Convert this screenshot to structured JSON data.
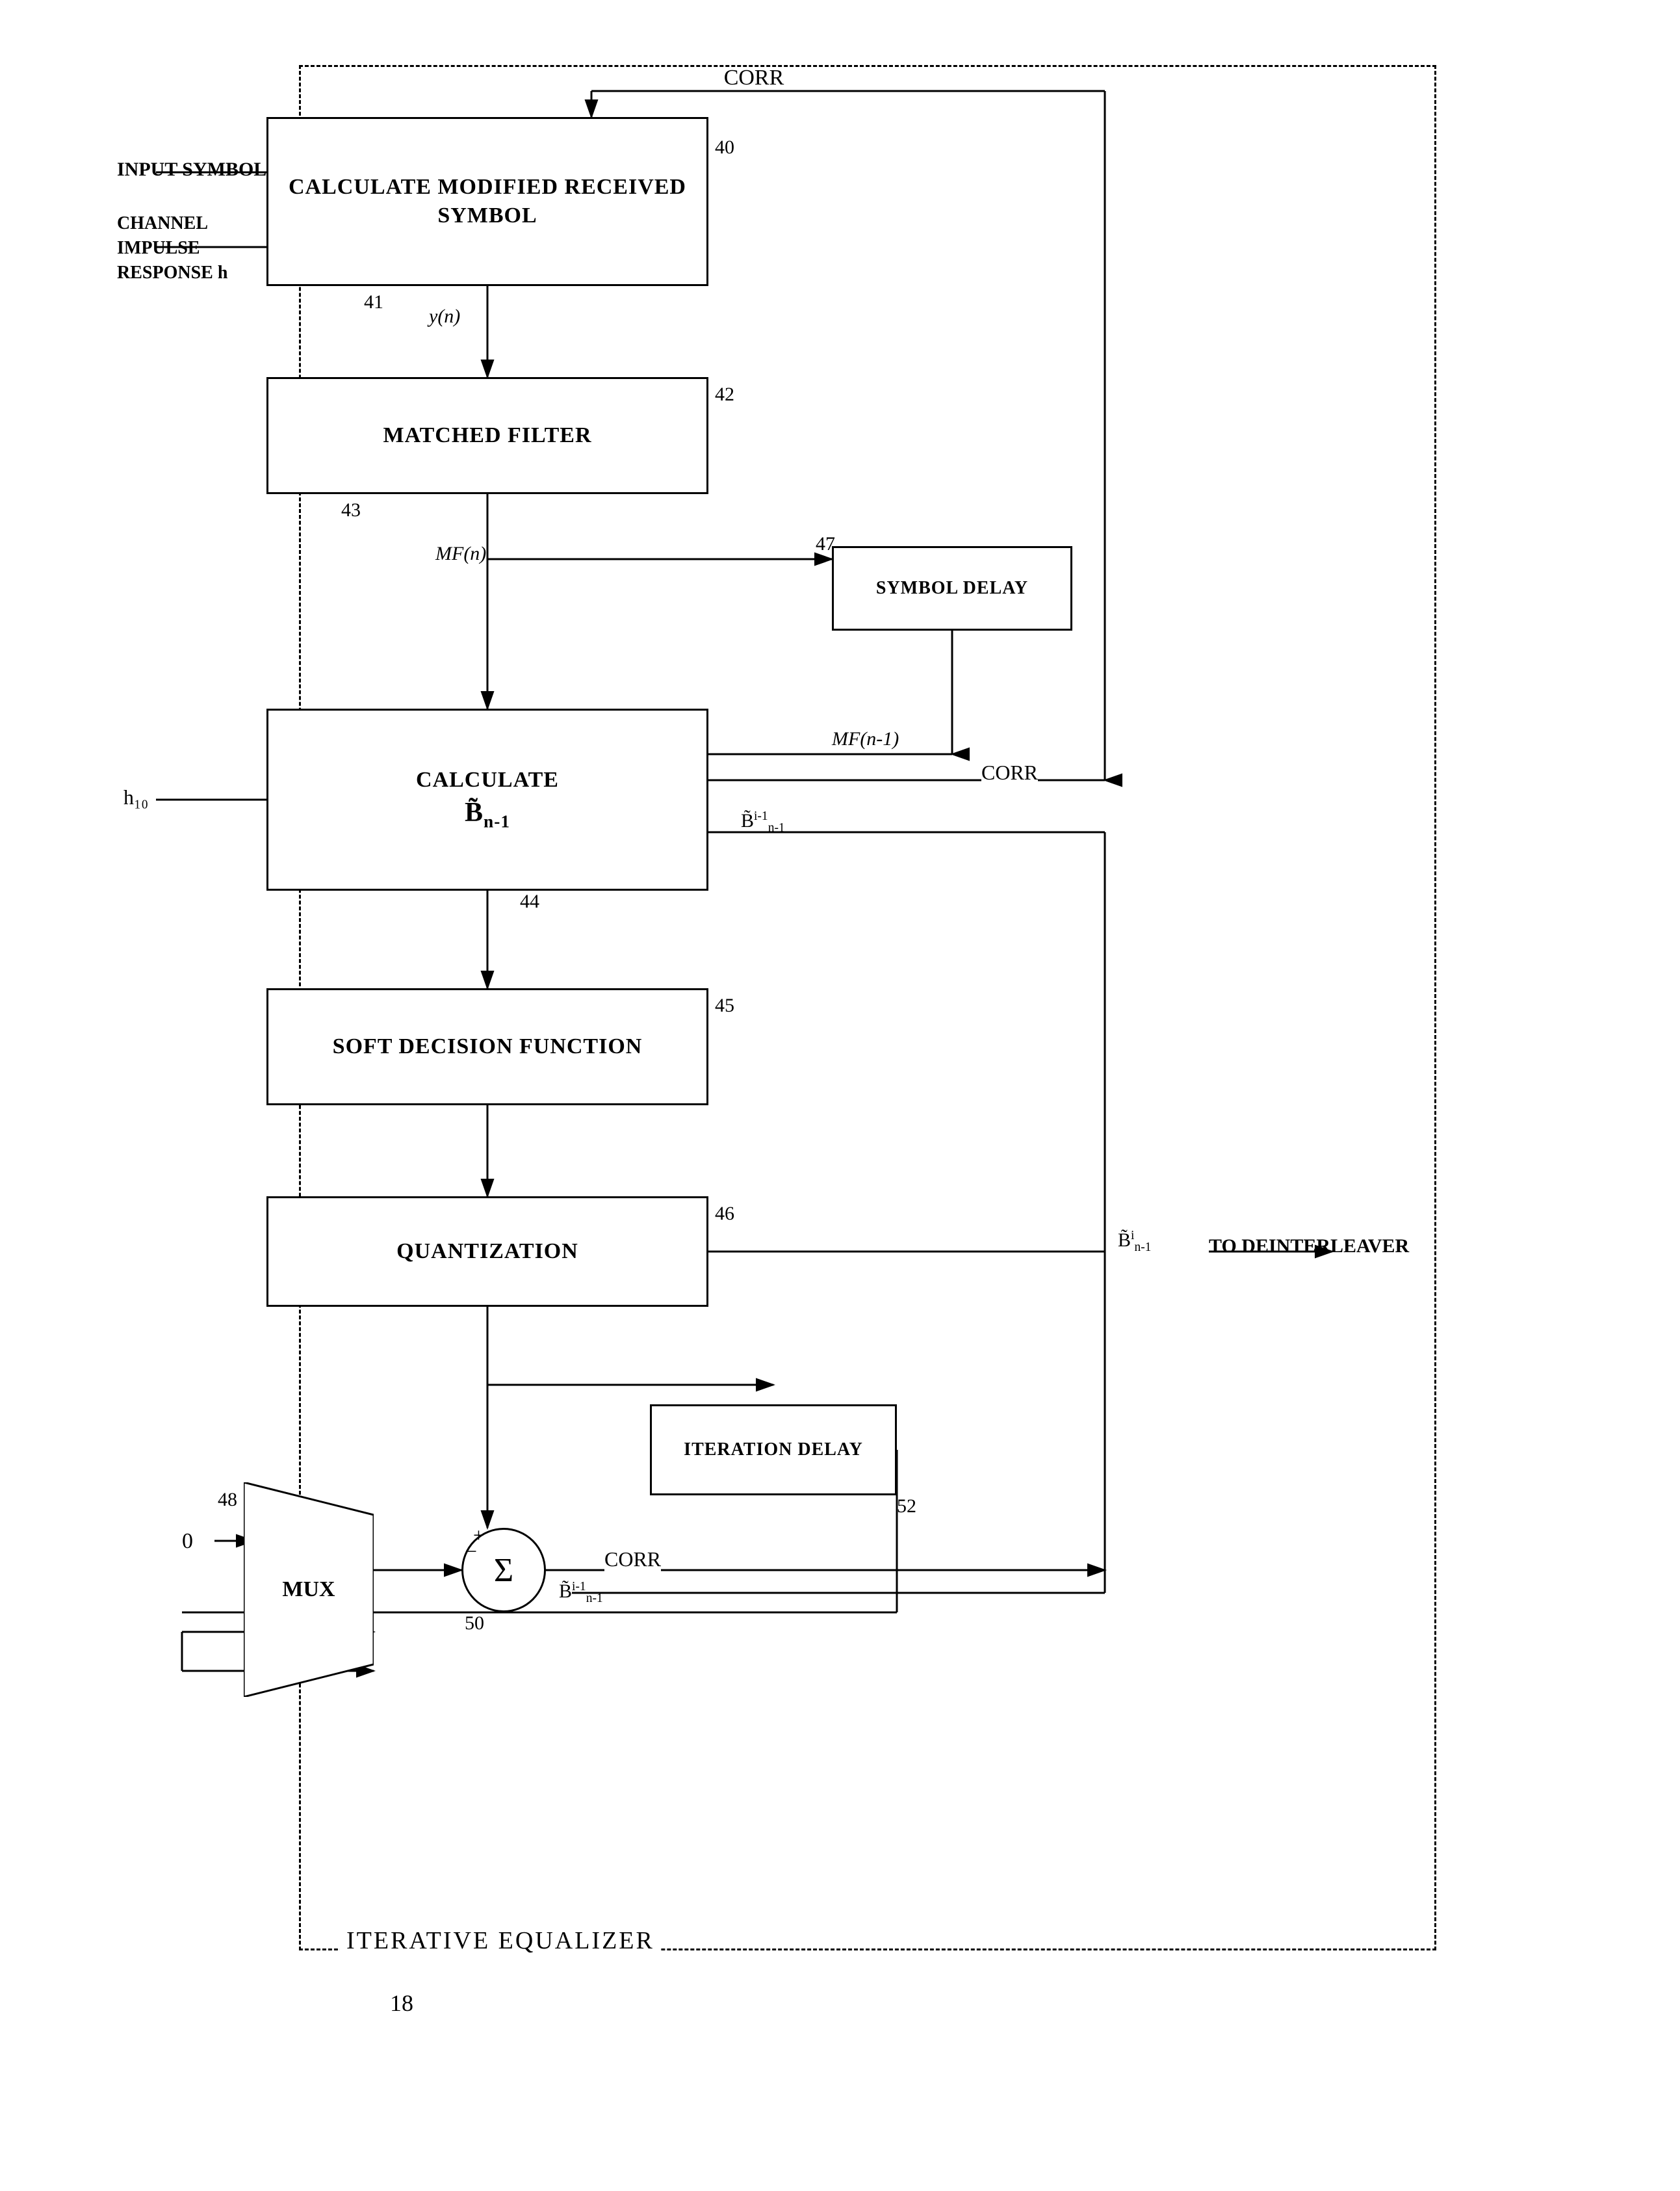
{
  "diagram": {
    "title": "ITERATIVE EQUALIZER",
    "diagram_label": "18",
    "outer_box_label": "ITERATIVE EQUALIZER",
    "blocks": {
      "b40": {
        "label": "CALCULATE MODIFIED RECEIVED SYMBOL",
        "number": "40"
      },
      "b42": {
        "label": "MATCHED FILTER",
        "number": "42"
      },
      "b47": {
        "label": "SYMBOL DELAY",
        "number": "47"
      },
      "b44_calc": {
        "label": "CALCULATE",
        "number": "44"
      },
      "b45": {
        "label": "SOFT DECISION FUNCTION",
        "number": "45"
      },
      "b46": {
        "label": "QUANTIZATION",
        "number": "46"
      },
      "b52": {
        "label": "ITERATION DELAY",
        "number": "52"
      },
      "b48": {
        "label": "MUX",
        "number": "48"
      }
    },
    "signals": {
      "corr_top": "CORR",
      "corr_mid": "CORR",
      "corr_bot": "CORR",
      "yn": "y(n)",
      "mfn": "MF(n)",
      "mfn1": "MF(n-1)",
      "b_tilde_i1_sub": "B̃ⁱ⁻¹ₙ₋₁",
      "b_tilde_i_sub": "B̃ⁱₙ₋₁",
      "b_tilde_label_right": "B̃ⁱₙ₋₁",
      "to_deinterleaver": "TO DEINTERLEAVER",
      "h10": "h₁₀",
      "input_symbol": "INPUT SYMBOL",
      "channel_impulse": "CHANNEL IMPULSE RESPONSE h",
      "zero_input": "0",
      "label_41": "41",
      "label_43": "43",
      "label_44": "44",
      "label_45": "45",
      "label_46": "46",
      "label_47": "47",
      "label_48": "48",
      "label_50": "50",
      "label_52": "52"
    }
  }
}
